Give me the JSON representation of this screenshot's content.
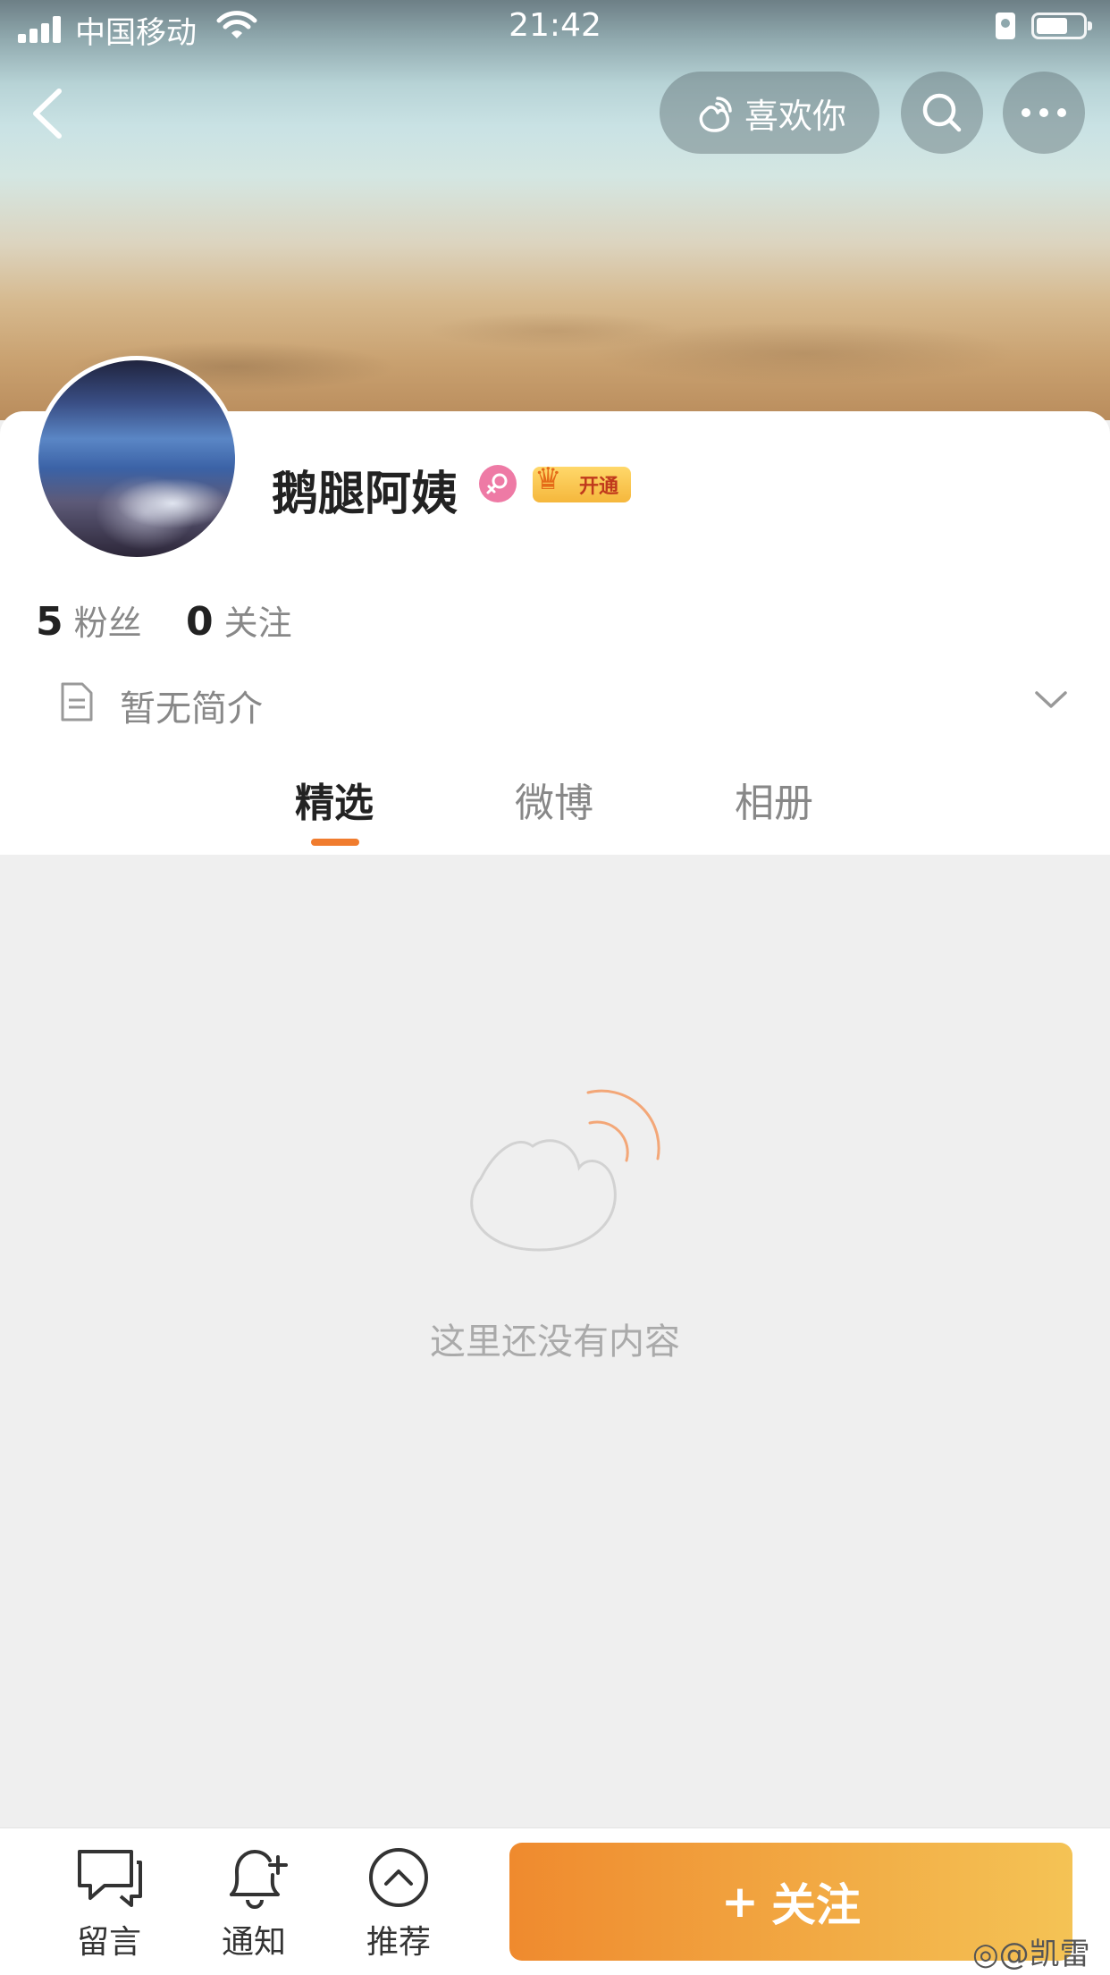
{
  "status_bar": {
    "carrier": "中国移动",
    "time": "21:42"
  },
  "header": {
    "like_label": "喜欢你"
  },
  "profile": {
    "name": "鹅腿阿姨",
    "vip_badge": "开通",
    "followers_count": "5",
    "followers_label": "粉丝",
    "following_count": "0",
    "following_label": "关注",
    "bio": "暂无简介"
  },
  "tabs": [
    {
      "label": "精选",
      "active": true
    },
    {
      "label": "微博",
      "active": false
    },
    {
      "label": "相册",
      "active": false
    }
  ],
  "empty_state": {
    "text": "这里还没有内容"
  },
  "bottom_bar": {
    "message_label": "留言",
    "notify_label": "通知",
    "recommend_label": "推荐",
    "follow_label": "关注",
    "follow_plus": "+"
  },
  "watermark": "@凯雷",
  "colors": {
    "accent": "#f07c2e",
    "follow_gradient_start": "#ef8a2e",
    "follow_gradient_end": "#f4c355",
    "female_badge": "#ee7aa5"
  }
}
